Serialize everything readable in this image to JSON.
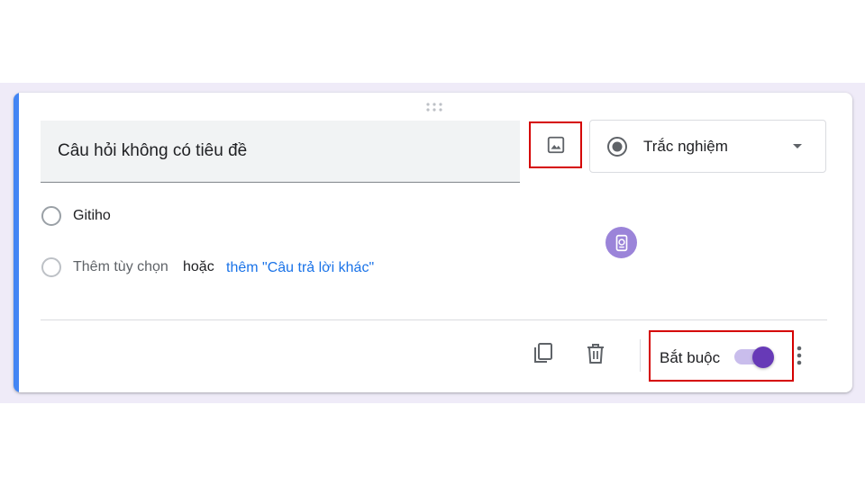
{
  "question": {
    "title": "Câu hỏi không có tiêu đề"
  },
  "question_type": {
    "selected": "Trắc nghiệm",
    "icon": "radio-button-icon"
  },
  "options": {
    "items": [
      {
        "label": "Gitiho"
      }
    ],
    "add_option_label": "Thêm tùy chọn",
    "or_label": "hoặc",
    "add_other_label": "thêm \"Câu trả lời khác\""
  },
  "footer": {
    "required_label": "Bắt buộc",
    "required_on": true
  },
  "colors": {
    "accent": "#4285f4",
    "toggle_on": "#673ab7",
    "highlight": "#d50000",
    "link": "#1a73e8"
  },
  "icons": [
    "drag-handle-icon",
    "image-icon",
    "dropdown-caret-icon",
    "copy-icon",
    "delete-icon",
    "more-vert-icon",
    "logo-icon"
  ]
}
